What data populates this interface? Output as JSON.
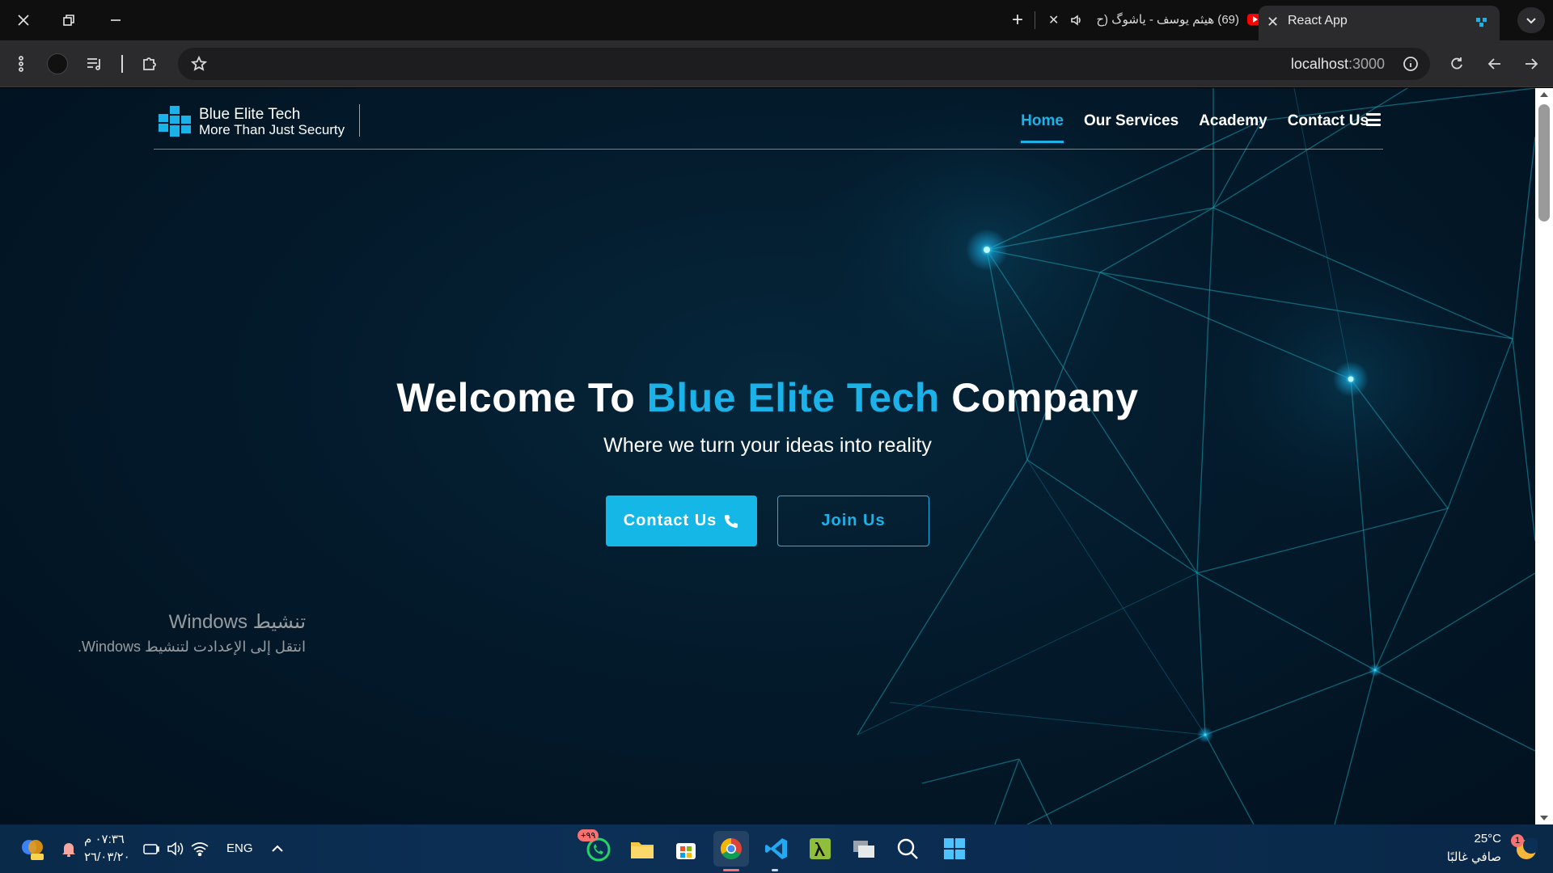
{
  "browser": {
    "active_tab": {
      "title": "React App"
    },
    "inactive_tab": {
      "title": "(69) هيثم يوسف - ياشوگ (ح"
    },
    "url": {
      "host": "localhost",
      "port": ":3000"
    }
  },
  "site": {
    "brand": {
      "name": "Blue Elite Tech",
      "tagline": "More Than Just Securty"
    },
    "nav": [
      {
        "label": "Home",
        "active": true
      },
      {
        "label": "Our Services",
        "active": false
      },
      {
        "label": "Academy",
        "active": false
      },
      {
        "label": "Contact Us",
        "active": false
      }
    ],
    "hero": {
      "title_start": "Welcome To ",
      "title_accent": "Blue Elite Tech",
      "title_end": " Company",
      "subtitle": "Where we turn your ideas into reality",
      "contact_button": "Contact Us",
      "join_button": "Join Us"
    },
    "colors": {
      "accent": "#1ab2e8",
      "background": "#031a2b"
    }
  },
  "windows_activation": {
    "title": "تنشيط Windows",
    "message": "انتقل إلى الإعدادت لتنشيط Windows."
  },
  "taskbar": {
    "time": "٠٧:٣٦ م",
    "date": "٢٦/٠٣/٢٠",
    "language": "ENG",
    "whatsapp_badge": "+٩٩",
    "weather": {
      "temp": "25°C",
      "condition": "صافي غالبًا",
      "badge": "1"
    }
  }
}
